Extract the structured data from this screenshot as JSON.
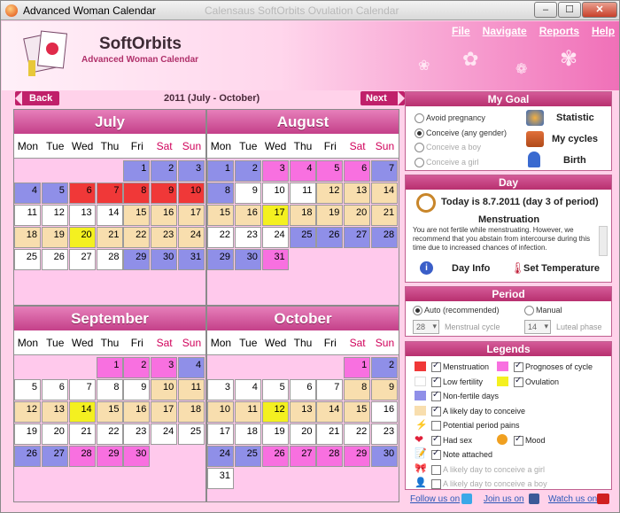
{
  "window": {
    "title": "Advanced Woman Calendar",
    "ghost_title": "Calensaus SoftOrbits Ovulation Calendar",
    "min": "–",
    "max": "☐",
    "close": "✕"
  },
  "brand": {
    "name": "SoftOrbits",
    "subtitle": "Advanced Woman Calendar"
  },
  "menu": [
    "File",
    "Navigate",
    "Reports",
    "Help"
  ],
  "nav": {
    "back": "Back",
    "next": "Next",
    "range": "2011 (July - October)"
  },
  "weekdays": [
    "Mon",
    "Tue",
    "Wed",
    "Thu",
    "Fri",
    "Sat",
    "Sun"
  ],
  "colors": {
    "menstruation": "#f03838",
    "low_fertility": "#ffffff",
    "non_fertile": "#8f8fe8",
    "likely_conceive": "#f8deae",
    "prognoses": "#f870e0",
    "ovulation": "#f4f020",
    "pink": "#ffc9ec"
  },
  "months": [
    {
      "name": "July",
      "start": 4,
      "length": 31,
      "day_colors": [
        "non_fertile",
        "non_fertile",
        "non_fertile",
        "non_fertile",
        "non_fertile",
        "menstruation",
        "menstruation",
        "menstruation",
        "menstruation",
        "menstruation",
        "low_fertility",
        "low_fertility",
        "low_fertility",
        "low_fertility",
        "likely_conceive",
        "likely_conceive",
        "likely_conceive",
        "likely_conceive",
        "likely_conceive",
        "ovulation",
        "likely_conceive",
        "likely_conceive",
        "likely_conceive",
        "likely_conceive",
        "low_fertility",
        "low_fertility",
        "low_fertility",
        "low_fertility",
        "non_fertile",
        "non_fertile",
        "non_fertile"
      ]
    },
    {
      "name": "August",
      "start": 0,
      "length": 31,
      "day_colors": [
        "non_fertile",
        "non_fertile",
        "prognoses",
        "prognoses",
        "prognoses",
        "prognoses",
        "non_fertile",
        "non_fertile",
        "low_fertility",
        "low_fertility",
        "low_fertility",
        "likely_conceive",
        "likely_conceive",
        "likely_conceive",
        "likely_conceive",
        "likely_conceive",
        "ovulation",
        "likely_conceive",
        "likely_conceive",
        "likely_conceive",
        "likely_conceive",
        "low_fertility",
        "low_fertility",
        "low_fertility",
        "non_fertile",
        "non_fertile",
        "non_fertile",
        "non_fertile",
        "non_fertile",
        "non_fertile",
        "prognoses"
      ]
    },
    {
      "name": "September",
      "start": 3,
      "length": 30,
      "day_colors": [
        "prognoses",
        "prognoses",
        "prognoses",
        "non_fertile",
        "low_fertility",
        "low_fertility",
        "low_fertility",
        "low_fertility",
        "low_fertility",
        "likely_conceive",
        "likely_conceive",
        "likely_conceive",
        "likely_conceive",
        "ovulation",
        "likely_conceive",
        "likely_conceive",
        "likely_conceive",
        "likely_conceive",
        "low_fertility",
        "low_fertility",
        "low_fertility",
        "low_fertility",
        "low_fertility",
        "low_fertility",
        "low_fertility",
        "non_fertile",
        "non_fertile",
        "prognoses",
        "prognoses",
        "prognoses"
      ]
    },
    {
      "name": "October",
      "start": 5,
      "length": 31,
      "day_colors": [
        "prognoses",
        "non_fertile",
        "low_fertility",
        "low_fertility",
        "low_fertility",
        "low_fertility",
        "low_fertility",
        "likely_conceive",
        "likely_conceive",
        "likely_conceive",
        "likely_conceive",
        "ovulation",
        "likely_conceive",
        "likely_conceive",
        "likely_conceive",
        "low_fertility",
        "low_fertility",
        "low_fertility",
        "low_fertility",
        "low_fertility",
        "low_fertility",
        "low_fertility",
        "low_fertility",
        "non_fertile",
        "non_fertile",
        "prognoses",
        "prognoses",
        "prognoses",
        "prognoses",
        "non_fertile",
        "low_fertility"
      ]
    }
  ],
  "goal": {
    "title": "My Goal",
    "options": [
      "Avoid pregnancy",
      "Conceive (any gender)",
      "Conceive a boy",
      "Conceive a girl"
    ],
    "links": [
      "Statistic",
      "My cycles",
      "Birth"
    ]
  },
  "day": {
    "title": "Day",
    "today": "Today is 8.7.2011 (day 3 of period)",
    "heading": "Menstruation",
    "text": "You are not fertile while menstruating. However, we recommend that you abstain from intercourse during this time due to increased chances of infection.",
    "info": "Day Info",
    "temp": "Set Temperature"
  },
  "period": {
    "title": "Period",
    "auto": "Auto (recommended)",
    "manual": "Manual",
    "cycle_value": "28",
    "cycle_label": "Menstrual cycle",
    "luteal_value": "14",
    "luteal_label": "Luteal phase"
  },
  "legends": {
    "title": "Legends",
    "items": [
      "Menstruation",
      "Prognoses of cycle",
      "Low fertility",
      "Ovulation",
      "Non-fertile days",
      "A likely day to conceive",
      "Potential period pains",
      "Had sex",
      "Mood",
      "Note attached",
      "A likely day to conceive a girl",
      "A likely day to conceive a boy"
    ]
  },
  "footer": [
    "Follow us on",
    "Join us on",
    "Watch us on"
  ]
}
